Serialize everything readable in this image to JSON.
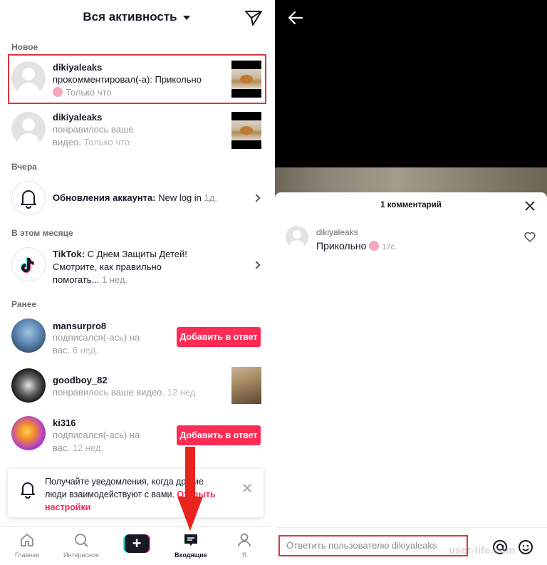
{
  "left": {
    "header": {
      "title": "Вся активность"
    },
    "sections": {
      "new": "Новое",
      "yesterday": "Вчера",
      "this_month": "В этом месяце",
      "earlier": "Ранее"
    },
    "notifications": [
      {
        "user": "dikiyaleaks",
        "text": "прокомментировал(-а): Прикольно",
        "time": "Только что"
      },
      {
        "user": "dikiyaleaks",
        "text1": "понравилось ваше",
        "text2": "видео.",
        "time": "Только что"
      },
      {
        "title": "Обновления аккаунта:",
        "text": "New log in",
        "time": "1д."
      },
      {
        "title": "TikTok:",
        "text1": "С Днем Защиты Детей!",
        "text2": "Смотрите, как правильно",
        "text3": "помогать...",
        "time": "1 нед."
      },
      {
        "user": "mansurpro8",
        "text1": "подписался(-ась) на",
        "text2": "вас.",
        "time": "6 нед.",
        "button": "Добавить в ответ"
      },
      {
        "user": "goodboy_82",
        "text": "понравилось ваше видео.",
        "time": "12 нед."
      },
      {
        "user": "ki316",
        "text1": "подписался(-ась) на",
        "text2": "вас.",
        "time": "12 нед.",
        "button": "Добавить в ответ"
      }
    ],
    "notice": {
      "text1": "Получайте уведомления, когда другие",
      "text2": "люди взаимодействуют с вами.",
      "link1": "Открыть",
      "link2": "настройки"
    },
    "tabs": [
      {
        "label": "Главная"
      },
      {
        "label": "Интересное"
      },
      {
        "label": ""
      },
      {
        "label": "Входящие"
      },
      {
        "label": "Я"
      }
    ]
  },
  "right": {
    "comments_count": "1 комментарий",
    "comment": {
      "user": "dikiyaleaks",
      "text": "Прикольно",
      "time": "17с."
    },
    "reply_placeholder": "Ответить пользователю dikiyaleaks",
    "watermark": "user-life.com"
  },
  "colors": {
    "accent": "#fe2c55",
    "highlight": "#d9383e"
  }
}
